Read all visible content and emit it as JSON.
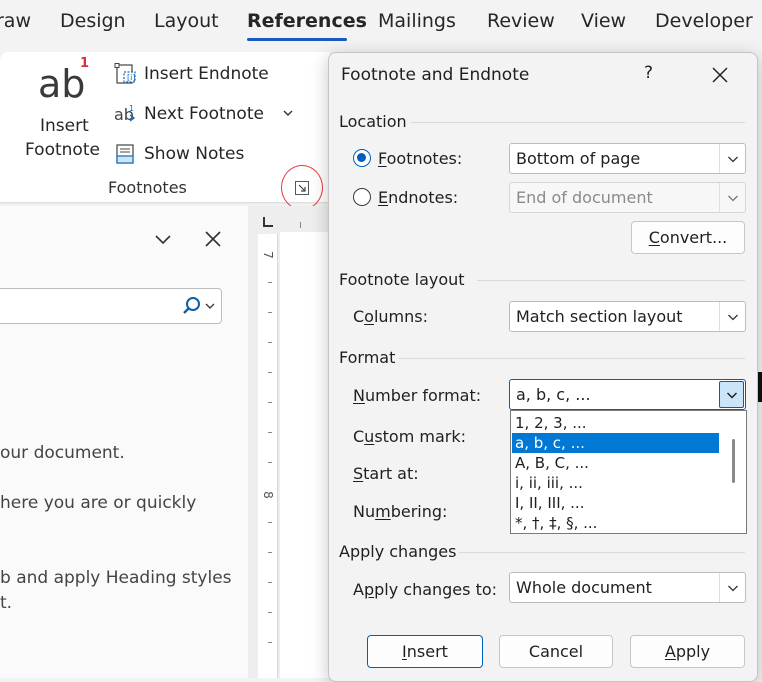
{
  "ribbon_tabs": [
    {
      "label": "raw"
    },
    {
      "label": "Design"
    },
    {
      "label": "Layout"
    },
    {
      "label": "References",
      "active": true
    },
    {
      "label": "Mailings"
    },
    {
      "label": "Review"
    },
    {
      "label": "View"
    },
    {
      "label": "Developer"
    }
  ],
  "ribbon": {
    "insert_footnote": {
      "icon_text": "ab",
      "superscript": "1",
      "line1": "Insert",
      "line2": "Footnote"
    },
    "insert_endnote": "Insert Endnote",
    "next_footnote": "Next Footnote",
    "show_notes": "Show Notes",
    "group_label": "Footnotes"
  },
  "nav_pane": {
    "text_lines": [
      "our document.",
      "here you are or quickly",
      "b and apply Heading styles",
      "t."
    ]
  },
  "ruler": {
    "numbers": [
      "7",
      "8"
    ]
  },
  "dialog": {
    "title": "Footnote and Endnote",
    "help": "?",
    "location": {
      "section": "Location",
      "footnotes_label_pre": "",
      "footnotes_label_u": "F",
      "footnotes_label_post": "ootnotes:",
      "footnotes_value": "Bottom of page",
      "endnotes_label_pre": "",
      "endnotes_label_u": "E",
      "endnotes_label_post": "ndnotes:",
      "endnotes_value": "End of document",
      "convert_pre": "",
      "convert_u": "C",
      "convert_post": "onvert..."
    },
    "footnote_layout": {
      "section": "Footnote layout",
      "columns_pre": "C",
      "columns_u": "o",
      "columns_post": "lumns:",
      "columns_value": "Match section layout"
    },
    "format": {
      "section": "Format",
      "number_format_pre": "",
      "number_format_u": "N",
      "number_format_post": "umber format:",
      "number_format_value": "a, b, c, ...",
      "custom_mark_pre": "C",
      "custom_mark_u": "u",
      "custom_mark_post": "stom mark:",
      "start_at_pre": "",
      "start_at_u": "S",
      "start_at_post": "tart at:",
      "numbering_pre": "Nu",
      "numbering_u": "m",
      "numbering_post": "bering:",
      "dropdown_options": [
        "1, 2, 3, ...",
        "a, b, c, ...",
        "A, B, C, ...",
        "i, ii, iii, ...",
        "I, II, III, ...",
        "*, †, ‡, §, ..."
      ],
      "dropdown_selected": 1
    },
    "apply_changes": {
      "section": "Apply changes",
      "apply_to_pre": "A",
      "apply_to_u": "p",
      "apply_to_post": "ply changes to:",
      "apply_to_value": "Whole document"
    },
    "buttons": {
      "insert_pre": "",
      "insert_u": "I",
      "insert_post": "nsert",
      "cancel": "Cancel",
      "apply_pre": "",
      "apply_u": "A",
      "apply_post": "pply"
    }
  },
  "colors": {
    "accent": "#005fb8",
    "selection": "#0078d4",
    "annotation_circle": "#e8383d"
  }
}
